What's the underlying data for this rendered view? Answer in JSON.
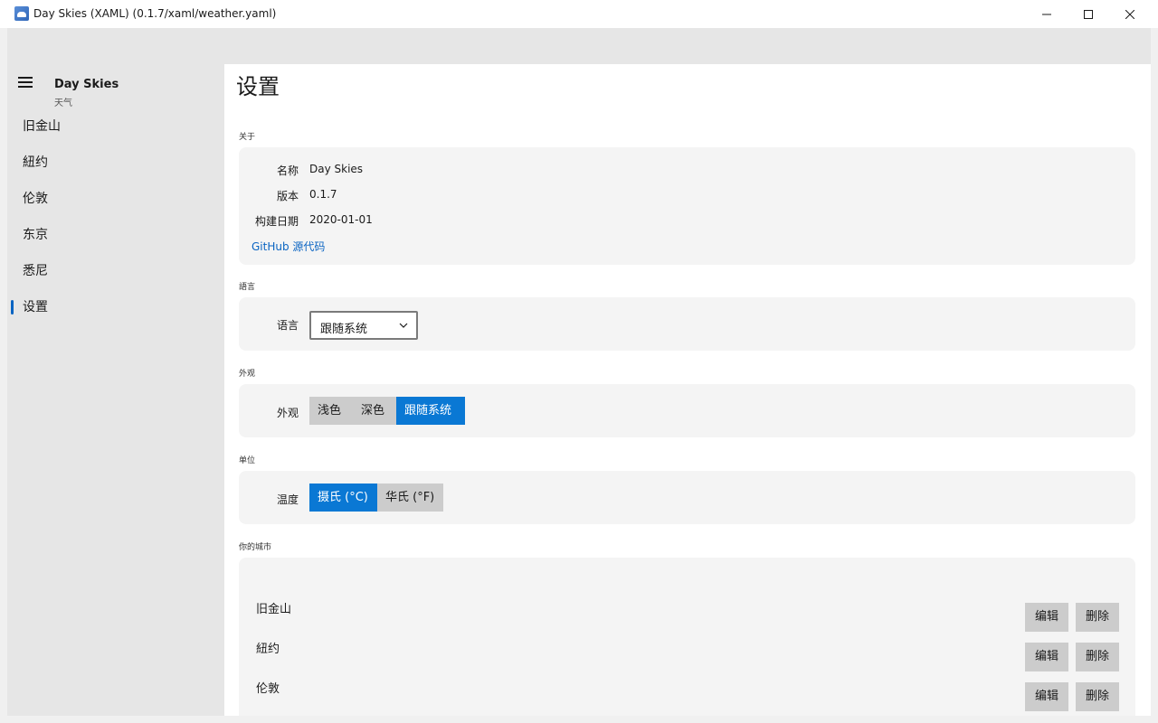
{
  "window": {
    "title": "Day Skies (XAML) (0.1.7/xaml/weather.yaml)",
    "controls": [
      "minimize-icon",
      "maximize-icon",
      "close-icon"
    ]
  },
  "sidebar": {
    "app_name": "Day Skies",
    "app_subtitle": "天气",
    "items": [
      {
        "label": "旧金山"
      },
      {
        "label": "紐约"
      },
      {
        "label": "伦敦"
      },
      {
        "label": "东京"
      },
      {
        "label": "悉尼"
      },
      {
        "label": "设置",
        "selected": true
      }
    ]
  },
  "page": {
    "title": "设置",
    "about": {
      "section": "关于",
      "name_label": "名称",
      "name_value": "Day Skies",
      "version_label": "版本",
      "version_value": "0.1.7",
      "build_label": "构建日期",
      "build_value": "2020-01-01",
      "source_link": "GitHub 源代码"
    },
    "language": {
      "section": "語言",
      "label": "语言",
      "selected": "跟随系统"
    },
    "appearance": {
      "section": "外观",
      "label": "外观",
      "options": [
        "浅色",
        "深色",
        "跟随系统"
      ],
      "selected_index": 2
    },
    "units": {
      "section": "单位",
      "label": "温度",
      "options": [
        "摄氏 (°C)",
        "华氏 (°F)"
      ],
      "selected_index": 0
    },
    "cities": {
      "section": "你的城市",
      "edit_label": "编辑",
      "delete_label": "删除",
      "items": [
        "旧金山",
        "紐约",
        "伦敦"
      ]
    }
  },
  "colors": {
    "accent": "#0a78d4",
    "link": "#0a64c2",
    "sidebar_bg": "#e6e6e6",
    "card_bg": "#f4f4f4"
  }
}
